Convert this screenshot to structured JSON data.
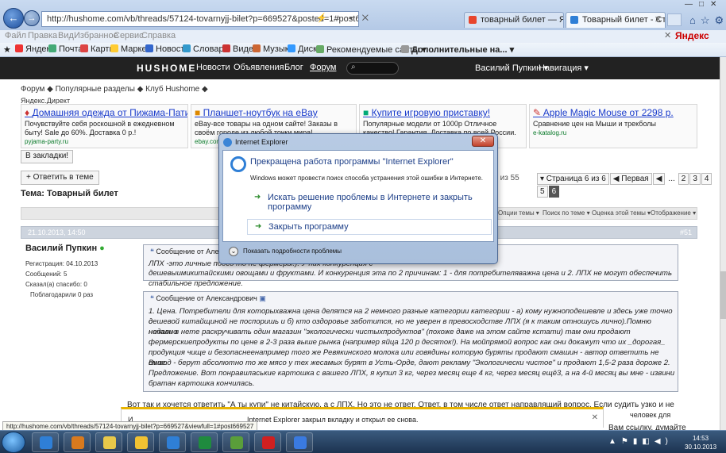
{
  "browser": {
    "address": "http://hushome.com/vb/threads/57124-tovarnyjj-bilet?p=669527&posted=1#post669527",
    "tabs": [
      {
        "label": "товарный билет — Яндекс: н..."
      },
      {
        "label": "Товарный билет - Страни..."
      }
    ],
    "menu": [
      "Файл",
      "Правка",
      "Вид",
      "Избранное",
      "Сервис",
      "Справка"
    ],
    "search_brand": "Яндекс",
    "favorites": [
      "Яндекс",
      "Почта",
      "Карты",
      "Маркет",
      "Новости",
      "Словари",
      "Видео",
      "Музыка",
      "Диск",
      "Рекомендуемые сайты ▾",
      "Дополнительные на..."
    ],
    "status_url": "http://hushome.com/vb/threads/57124-tovarnyjj-bilet?p=669527&viewfull=1#post669527"
  },
  "site": {
    "logo": "HUSHOME",
    "nav": [
      "Новости",
      "Объявления",
      "Блог",
      "Форум"
    ],
    "user": "Василий Пупкин ▾",
    "navigation": "Навигация ▾"
  },
  "breadcrumb": "Форум  ◆  Популярные разделы  ◆  Клуб Hushome  ◆",
  "direct_label": "Яндекс.Директ",
  "ads": [
    {
      "title": "Домашняя одежда от Пижама-Пати!",
      "desc": "Почувствуйте себя роскошной в ежедневном быту! Sale до 60%. Доставка 0 р.!",
      "url": "pyjama-party.ru"
    },
    {
      "title": "Планшет-ноутбук на eBay",
      "desc": "eBay-все товары на одном сайте! Заказы в своём городе из любой точки мира!",
      "url": "ebay.com"
    },
    {
      "title": "Купите игровую приставку!",
      "desc": "Популярные модели от 1000р Отличное качество! Гарантия. Доставка по всей России.",
      "url": ""
    },
    {
      "title": "Apple Magic Mouse от 2298 р.",
      "desc": "Сравнение цен на Мыши и трекболы",
      "url": "e-katalog.ru"
    }
  ],
  "bookmark_btn": "В закладки!",
  "reply_btn": "+ Ответить в теме",
  "thread_title": "Тема: Товарный билет",
  "post_count": "по 55 из 55",
  "pager": [
    "▾ Страница 6 из 6",
    "◀ Первая",
    "◀",
    "...",
    "2",
    "3",
    "4",
    "5",
    "6"
  ],
  "tools": [
    "Опции темы ▾",
    "Поиск по теме ▾",
    "Оценка этой темы ▾",
    "Отображение ▾"
  ],
  "post": {
    "date": "21.10.2013, 14:50",
    "num": "#51",
    "author": "Василий Пупкин",
    "info": [
      "Регистрация:   04.10.2013",
      "Сообщений:       5",
      "Сказал(а) спасибо:   0",
      "Поблагодарили 0 раз"
    ],
    "quote1_head": "Сообщение от Алекс",
    "quote1_text": [
      "ЛПХ -это личные подсо                                                                     то не фермеры!). У них конкуренция с",
      "дешевыимикитайскими овощами и фруктами. И конкуренция эта по 2 причинам: 1 - для потребителяважна цена и 2. ЛПХ не могут обеспечить стабильное предложение."
    ],
    "quote2_head": "Сообщение от Александрович",
    "quote2_text": [
      "1. Цена. Потребители для которыхважна цена делятся на 2 немного разные категории категории - а) кому нужноподешевле и здесь уже точно с",
      "дешевой китайщиной не поспоришь и б) кто оздоровье заботится, но не уверен в превосходстве ЛПХ (я к таким отношусь лично).Помню недавно",
      "начали в нете раскручивать один магазин \"экологически чистыхпродуктов\" (похоже даже на этом сайте кстати) там они продают",
      "фермерскиепродукты по цене в 2-3 раза выше рынка (например яйца 120 р десяток!). На мойпрямой вопрос как они докажут что их _дорогая_",
      "продукция чище и безопаснеенапример того же Ревякинского молока или говядины которую буряты продают смашин - автор ответить не смог.",
      "Вывод - берут абсолютно то же мясо у тех жесамых бурят в Усть-Орде, дают рекламу \"Экологически чистое\" и продают 1,5-2 раза дороже 2.",
      "Предложение. Вот понравиласькие картошка с вашего ЛПХ, я купил 3 кг, через месяц еще 4 кг, через месяц ещё3, а на 4-й месяц вы мне - извини",
      "братан картошка кончилась."
    ],
    "body": "Вот так и хочется ответить \"А ты купи\" не китайскую, а с ЛПХ. Но это не ответ. Ответ, в том числе ответ направлящий вопрос. Если судить узко и не глубоко, то Вы"
  },
  "notify": {
    "text": "Internet Explorer закрыл вкладку и открыл ее снова.",
    "left_fragment": "И",
    "right_fragment": "человек для",
    "right_fragment2": "Вам ссылку, думайте"
  },
  "dialog": {
    "title": "Internet Explorer",
    "heading": "Прекращена работа программы \"Internet Explorer\"",
    "sub": "Windows может провести поиск способа устранения этой ошибки в Интернете.",
    "option1": "Искать решение проблемы в Интернете и закрыть программу",
    "option2": "Закрыть программу",
    "details": "Показать подробности проблемы"
  },
  "taskbar": {
    "time": "14:53",
    "date": "30.10.2013",
    "app_colors": [
      "#2f7fd6",
      "#d97a1e",
      "#e8c84a",
      "#f1c232",
      "#2f7fd6",
      "#1f8b3e",
      "#5a9e3a",
      "#d02020",
      "#3a7ae0"
    ]
  }
}
